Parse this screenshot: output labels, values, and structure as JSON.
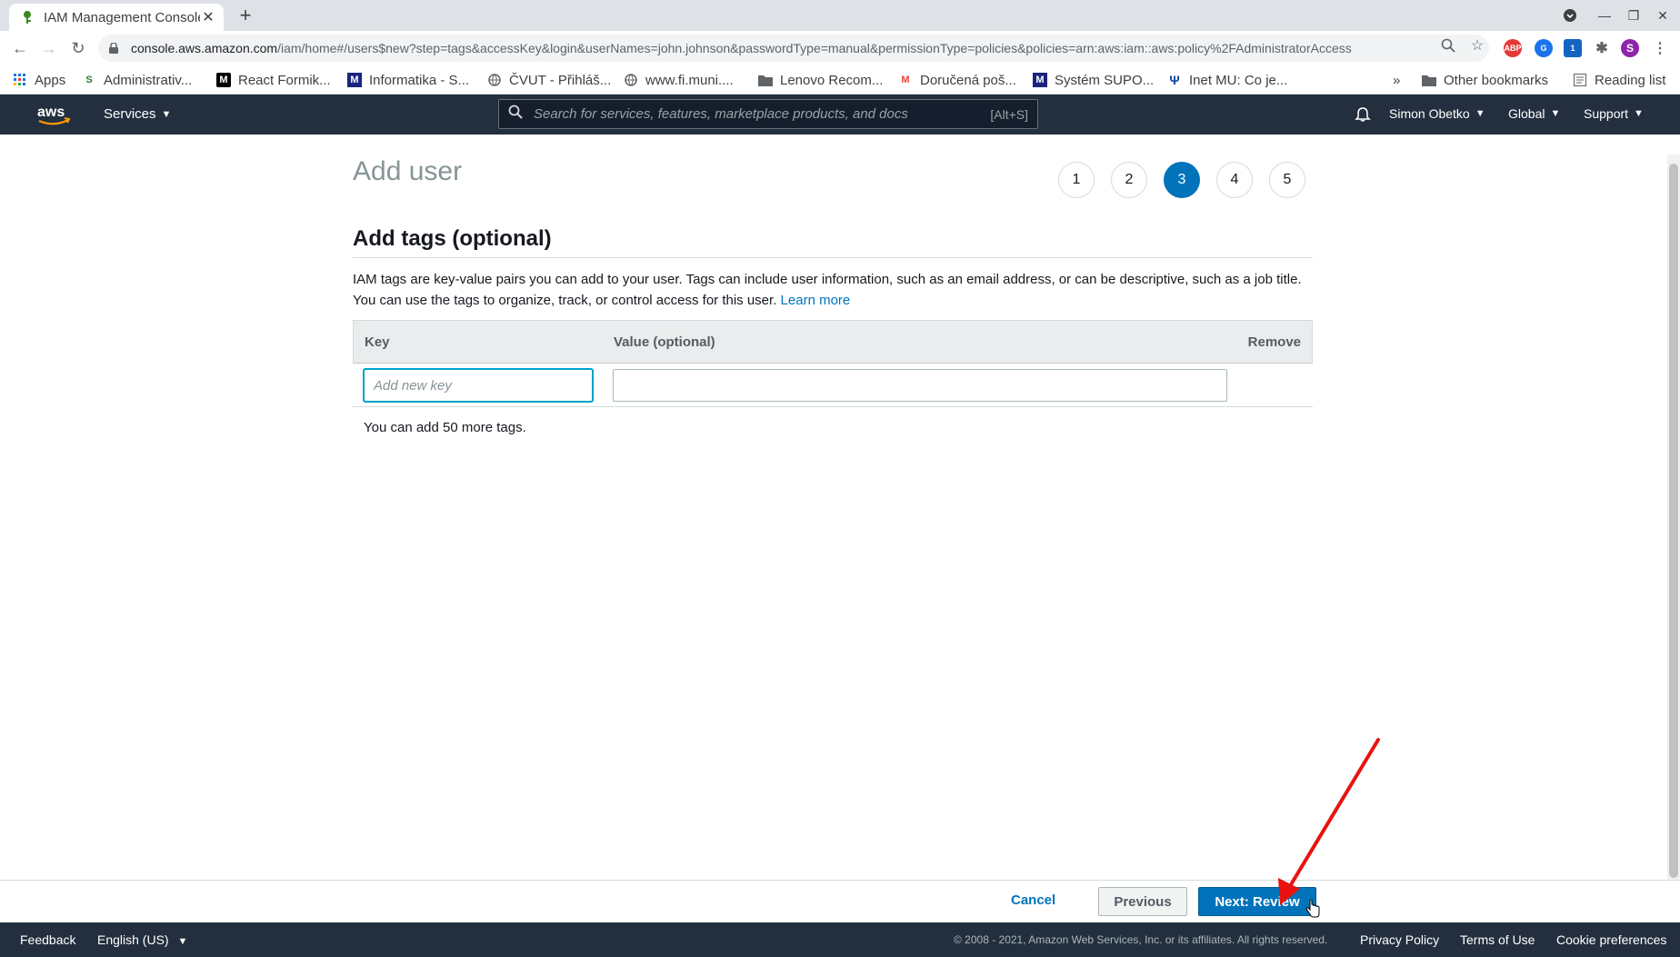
{
  "browser": {
    "tab_title": "IAM Management Console",
    "url_host": "console.aws.amazon.com",
    "url_path": "/iam/home#/users$new?step=tags&accessKey&login&userNames=john.johnson&passwordType=manual&permissionType=policies&policies=arn:aws:iam::aws:policy%2FAdministratorAccess",
    "bookmarks": [
      {
        "label": "Apps",
        "icon": "apps-grid-icon"
      },
      {
        "label": "Administrativ...",
        "icon": "is-icon"
      },
      {
        "label": "React Formik...",
        "icon": "medium-icon"
      },
      {
        "label": "Informatika - S...",
        "icon": "m-icon"
      },
      {
        "label": "ČVUT - Přihláš...",
        "icon": "globe-icon"
      },
      {
        "label": "www.fi.muni....",
        "icon": "globe-icon"
      },
      {
        "label": "Lenovo Recom...",
        "icon": "folder-icon"
      },
      {
        "label": "Doručená poš...",
        "icon": "gmail-icon"
      },
      {
        "label": "Systém SUPO...",
        "icon": "m-icon"
      },
      {
        "label": "Inet MU: Co je...",
        "icon": "mu-icon"
      }
    ],
    "overflow": "»",
    "other_bookmarks": "Other bookmarks",
    "reading_list": "Reading list",
    "profile_initial": "S",
    "extension_badge": "1"
  },
  "aws_nav": {
    "logo": "aws",
    "services": "Services",
    "search_placeholder": "Search for services, features, marketplace products, and docs",
    "search_shortcut": "[Alt+S]",
    "user": "Simon Obetko",
    "region": "Global",
    "support": "Support"
  },
  "page": {
    "title": "Add user",
    "steps": [
      "1",
      "2",
      "3",
      "4",
      "5"
    ],
    "active_step": "3",
    "section_title": "Add tags (optional)",
    "description": "IAM tags are key-value pairs you can add to your user. Tags can include user information, such as an email address, or can be descriptive, such as a job title. You can use the tags to organize, track, or control access for this user.",
    "learn_more": "Learn more",
    "table": {
      "columns": [
        "Key",
        "Value (optional)",
        "Remove"
      ],
      "key_placeholder": "Add new key",
      "key_value": "",
      "value_value": ""
    },
    "tags_note": "You can add 50 more tags."
  },
  "actions": {
    "cancel": "Cancel",
    "previous": "Previous",
    "next": "Next: Review"
  },
  "footer": {
    "feedback": "Feedback",
    "language": "English (US)",
    "copyright": "© 2008 - 2021, Amazon Web Services, Inc. or its affiliates. All rights reserved.",
    "privacy": "Privacy Policy",
    "terms": "Terms of Use",
    "cookies": "Cookie preferences"
  },
  "colors": {
    "aws_nav": "#232f3e",
    "primary_blue": "#0073bb",
    "annotation_arrow": "#e8130f"
  }
}
